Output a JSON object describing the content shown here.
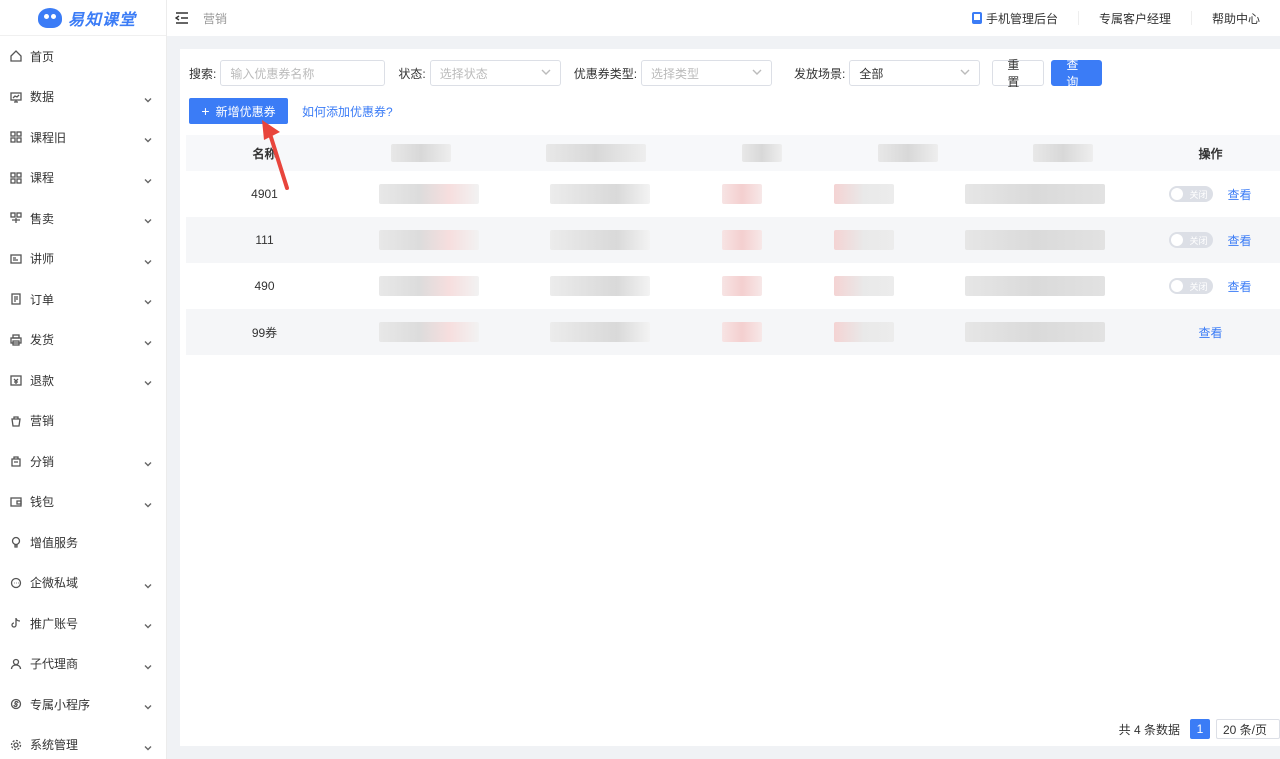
{
  "brand": {
    "name": "易知课堂",
    "accent": "#3b7cf6"
  },
  "sidebar": {
    "items": [
      {
        "label": "首页",
        "icon": "home-icon",
        "expandable": false
      },
      {
        "label": "数据",
        "icon": "chart-icon",
        "expandable": true
      },
      {
        "label": "课程旧",
        "icon": "grid-icon",
        "expandable": true
      },
      {
        "label": "课程",
        "icon": "grid-icon",
        "expandable": true
      },
      {
        "label": "售卖",
        "icon": "shop-icon",
        "expandable": true
      },
      {
        "label": "讲师",
        "icon": "teacher-icon",
        "expandable": true
      },
      {
        "label": "订单",
        "icon": "order-icon",
        "expandable": true
      },
      {
        "label": "发货",
        "icon": "print-icon",
        "expandable": true
      },
      {
        "label": "退款",
        "icon": "refund-icon",
        "expandable": true
      },
      {
        "label": "营销",
        "icon": "bag-icon",
        "expandable": false
      },
      {
        "label": "分销",
        "icon": "share-bag-icon",
        "expandable": true
      },
      {
        "label": "钱包",
        "icon": "wallet-icon",
        "expandable": true
      },
      {
        "label": "增值服务",
        "icon": "bulb-icon",
        "expandable": false
      },
      {
        "label": "企微私域",
        "icon": "chat-icon",
        "expandable": true
      },
      {
        "label": "推广账号",
        "icon": "tiktok-icon",
        "expandable": true
      },
      {
        "label": "子代理商",
        "icon": "user-icon",
        "expandable": true
      },
      {
        "label": "专属小程序",
        "icon": "miniapp-icon",
        "expandable": true
      },
      {
        "label": "系统管理",
        "icon": "gear-icon",
        "expandable": true
      }
    ]
  },
  "header": {
    "breadcrumb": "营销",
    "links": [
      "手机管理后台",
      "专属客户经理",
      "帮助中心"
    ]
  },
  "filters": {
    "search_label": "搜索:",
    "search_placeholder": "输入优惠券名称",
    "status_label": "状态:",
    "status_placeholder": "选择状态",
    "type_label": "优惠券类型:",
    "type_placeholder": "选择类型",
    "scene_label": "发放场景:",
    "scene_value": "全部",
    "reset_label": "重 置",
    "query_label": "查 询"
  },
  "actions": {
    "add_label": "新增优惠券",
    "help_link": "如何添加优惠券?"
  },
  "table": {
    "headers": {
      "name": "名称",
      "ops": "操作"
    },
    "rows": [
      {
        "name": "4901",
        "toggle": "关闭",
        "view": "查看",
        "has_toggle": true
      },
      {
        "name": "111",
        "toggle": "关闭",
        "view": "查看",
        "has_toggle": true
      },
      {
        "name": "490",
        "toggle": "关闭",
        "view": "查看",
        "has_toggle": true
      },
      {
        "name": "99券",
        "toggle": "",
        "view": "查看",
        "has_toggle": false
      }
    ]
  },
  "pagination": {
    "total_text": "共 4 条数据",
    "current_page": "1",
    "page_size": "20 条/页"
  }
}
